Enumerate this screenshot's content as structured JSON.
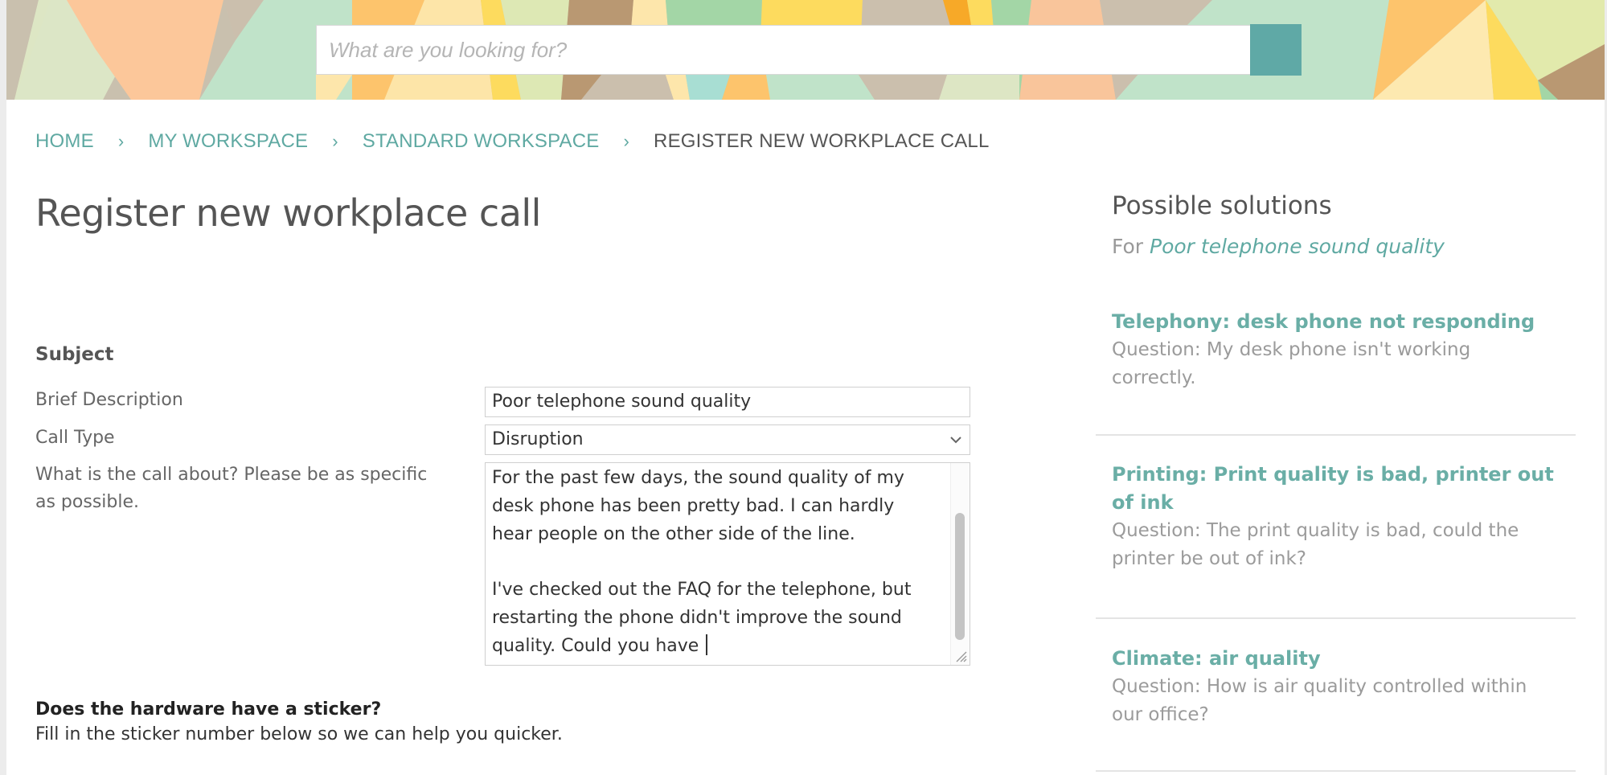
{
  "search": {
    "placeholder": "What are you looking for?",
    "button_icon": "search-icon"
  },
  "breadcrumb": [
    {
      "label": "HOME",
      "current": false
    },
    {
      "label": "MY WORKSPACE",
      "current": false
    },
    {
      "label": "STANDARD WORKSPACE",
      "current": false
    },
    {
      "label": "REGISTER NEW WORKPLACE CALL",
      "current": true
    }
  ],
  "breadcrumb_separator": "›",
  "page_title": "Register new workplace call",
  "form": {
    "section_heading": "Subject",
    "brief_description": {
      "label": "Brief Description",
      "value": "Poor telephone sound quality"
    },
    "call_type": {
      "label": "Call Type",
      "value": "Disruption"
    },
    "details": {
      "label": "What is the call about? Please be as specific as possible.",
      "value": "For the past few days, the sound quality of my\ndesk phone has been pretty bad. I can hardly\nhear people on the other side of the line.\n\nI've checked out the FAQ for the telephone, but\nrestarting the phone didn't improve the sound\nquality. Could you have "
    },
    "sticker": {
      "heading": "Does the hardware have a sticker?",
      "help": "Fill in the sticker number below so we can help you quicker."
    }
  },
  "solutions": {
    "title": "Possible solutions",
    "for_prefix": "For",
    "for_topic": "Poor telephone sound quality",
    "items": [
      {
        "title": "Telephony: desk phone not responding",
        "question": "Question:  My desk phone isn't working correctly."
      },
      {
        "title": "Printing: Print quality is bad, printer out of ink",
        "question": "Question: The print quality is bad, could the printer be out of ink?"
      },
      {
        "title": "Climate: air quality",
        "question": "Question: How is air quality controlled within our office?"
      }
    ]
  },
  "colors": {
    "accent": "#5fa9a6",
    "link": "#5fa9a2",
    "text": "#555555",
    "muted": "#9b9b9b"
  }
}
